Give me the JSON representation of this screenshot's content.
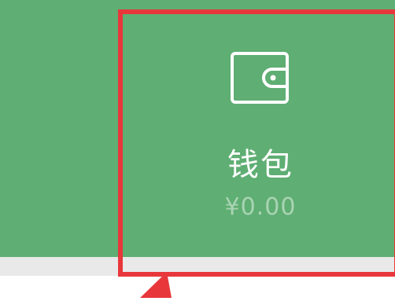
{
  "wallet": {
    "label": "钱包",
    "amount": "¥0.00",
    "icon": "wallet-icon"
  },
  "colors": {
    "tile_background": "#5fae73",
    "amount_text": "#a9d4b3",
    "highlight": "#e8373b",
    "divider": "#e9e9e9"
  }
}
